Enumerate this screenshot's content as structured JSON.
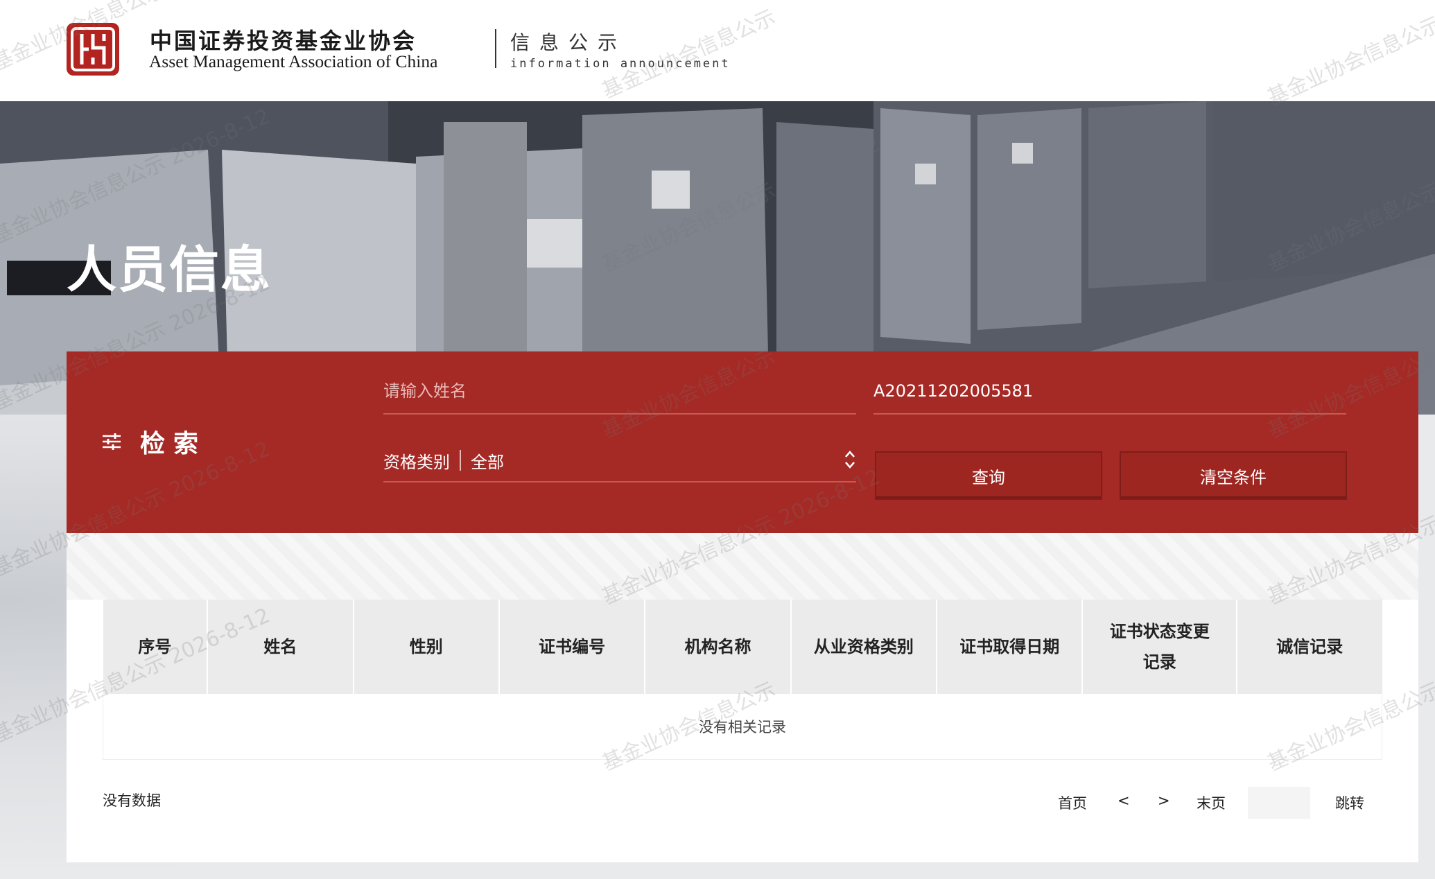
{
  "header": {
    "org_name_cn": "中国证券投资基金业协会",
    "org_name_en": "Asset Management Association of China",
    "section_cn": "信息公示",
    "section_en": "information announcement"
  },
  "banner": {
    "title": "人员信息"
  },
  "search": {
    "label": "检索",
    "name_placeholder": "请输入姓名",
    "cert_number_value": "A20211202005581",
    "qualification_label": "资格类别",
    "qualification_value": "全部",
    "query_button": "查询",
    "clear_button": "清空条件"
  },
  "table": {
    "columns": [
      "序号",
      "姓名",
      "性别",
      "证书编号",
      "机构名称",
      "从业资格类别",
      "证书取得日期",
      "证书状态变更记录",
      "诚信记录"
    ],
    "empty_text": "没有相关记录"
  },
  "footer": {
    "status": "没有数据",
    "first": "首页",
    "prev": "<",
    "next": ">",
    "last": "末页",
    "jump": "跳转"
  },
  "watermark": {
    "text_a": "基金业协会信息公示",
    "text_b": "基金业协会信息公示 2026-8-12"
  },
  "colors": {
    "brand_red": "#a52925",
    "button_red": "#9d2621"
  }
}
